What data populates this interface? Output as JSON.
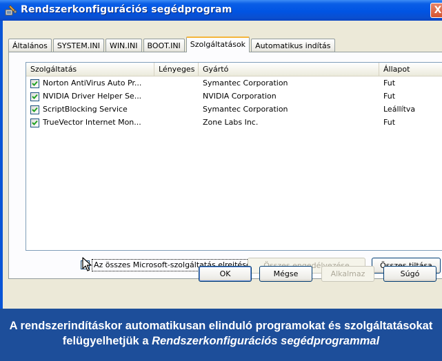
{
  "window": {
    "title": "Rendszerkonfigurációs segédprogram",
    "close_symbol": "X"
  },
  "tabs": [
    {
      "label": "Általános",
      "active": false
    },
    {
      "label": "SYSTEM.INI",
      "active": false
    },
    {
      "label": "WIN.INI",
      "active": false
    },
    {
      "label": "BOOT.INI",
      "active": false
    },
    {
      "label": "Szolgáltatások",
      "active": true
    },
    {
      "label": "Automatikus indítás",
      "active": false
    }
  ],
  "list": {
    "columns": [
      "Szolgáltatás",
      "Lényeges",
      "Gyártó",
      "Állapot"
    ],
    "rows": [
      {
        "checked": true,
        "service": "Norton AntiVirus Auto Pr...",
        "essential": "",
        "vendor": "Symantec Corporation",
        "status": "Fut"
      },
      {
        "checked": true,
        "service": "NVIDIA Driver Helper Se...",
        "essential": "",
        "vendor": "NVIDIA Corporation",
        "status": "Fut"
      },
      {
        "checked": true,
        "service": "ScriptBlocking Service",
        "essential": "",
        "vendor": "Symantec Corporation",
        "status": "Leállítva"
      },
      {
        "checked": true,
        "service": "TrueVector Internet Mon...",
        "essential": "",
        "vendor": "Zone Labs Inc.",
        "status": "Fut"
      }
    ]
  },
  "controls": {
    "hide_ms_label": "Az összes Microsoft-szolgáltatás elrejtése",
    "hide_ms_checked": true,
    "enable_all": "Összes engedélyezése",
    "disable_all": "Összes tiltása"
  },
  "dialog_buttons": {
    "ok": "OK",
    "cancel": "Mégse",
    "apply": "Alkalmaz",
    "help": "Súgó"
  },
  "caption": {
    "line1": "A rendszerindításkor automatikusan elinduló programokat és szolgáltatásokat",
    "line2_prefix": "felügyelhetjük a ",
    "line2_italic": "Rendszerkonfigurációs segédprogrammal"
  },
  "colors": {
    "titlebar": "#0054e3",
    "caption_bg": "#1d4e9a",
    "dialog_bg": "#ece9d8",
    "active_tab_accent": "#f5b53a"
  }
}
